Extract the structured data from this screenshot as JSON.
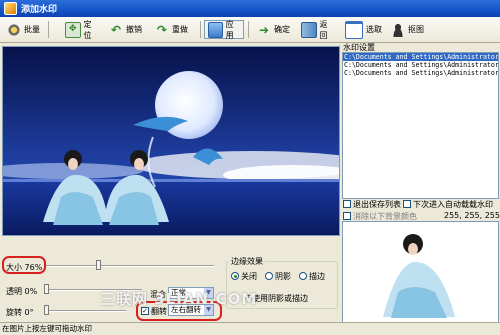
{
  "window": {
    "title": "添加水印"
  },
  "toolbar": {
    "batch": "批量",
    "locate": "定位",
    "undo": "撤销",
    "redo": "重做",
    "apply": "应用",
    "ok": "确定",
    "back": "返回",
    "select": "选取",
    "capture": "抠图"
  },
  "watermark_settings": {
    "title": "水印设置",
    "paths": [
      "C:\\Documents and Settings\\Administrator\\",
      "C:\\Documents and Settings\\Administrator\\",
      "C:\\Documents and Settings\\Administrator\\"
    ],
    "exit_save_list": "退出保存列表",
    "auto_load_next": "下次进入自动载载水印",
    "remove_bg_color": "消除以下背景颜色",
    "color_value": "255, 255, 255"
  },
  "controls": {
    "size_label": "大小 76%",
    "size_level": 0.76,
    "opacity_label": "透明 0%",
    "rotate_label": "旋转 0°",
    "blend_label": "混合",
    "blend_value": "正常",
    "flip_label": "翻转",
    "flip_checked": true,
    "flip_value": "左右翻转",
    "edge_effect_title": "边缘效果",
    "edge_options": [
      "关闭",
      "阴影",
      "描边"
    ],
    "edge_selected": "关闭",
    "no_shadow_note": "不使用阴影或描边"
  },
  "status": {
    "text": "在图片上按左键可拖动水印"
  },
  "watermark_text": "三联网 3LIAN.COM",
  "colors": {
    "title_bar": "#1554c8",
    "highlight_red": "#d92020",
    "selection": "#316ac5"
  }
}
